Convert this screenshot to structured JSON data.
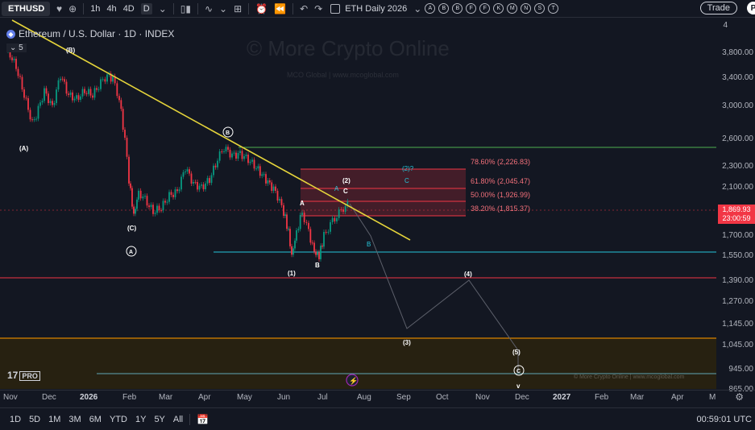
{
  "toolbar": {
    "symbol": "ETHUSD",
    "timeframes": [
      "1h",
      "4h",
      "4D",
      "D"
    ],
    "layout_name": "ETH Daily 2026",
    "drawing_tools": [
      "A",
      "B",
      "B",
      "F",
      "F",
      "K",
      "M",
      "N",
      "S",
      "T"
    ],
    "trade_label": "Trade",
    "profile_initial": "P"
  },
  "legend": {
    "title": "Ethereum / U.S. Dollar · 1D · INDEX",
    "indicators_count": "5"
  },
  "watermark": {
    "main": "© More Crypto Online",
    "sub": "MCO Global  |  www.mcoglobal.com",
    "bottom": "© More Crypto Online  |  www.mcoglobal.com"
  },
  "price_axis": {
    "labels": [
      "3,800.00",
      "3,400.00",
      "3,000.00",
      "2,600.00",
      "2,300.00",
      "2,100.00",
      "1,900.00",
      "1,700.00",
      "1,550.00",
      "1,390.00",
      "1,270.00",
      "1,145.00",
      "1,045.00",
      "945.00",
      "865.00"
    ],
    "top_value": "4",
    "current_price": "1,869.93",
    "countdown": "23:00:59"
  },
  "time_axis": {
    "labels": [
      "Nov",
      "Dec",
      "2026",
      "Feb",
      "Mar",
      "Apr",
      "May",
      "Jun",
      "Jul",
      "Aug",
      "Sep",
      "Oct",
      "Nov",
      "Dec",
      "2027",
      "Feb",
      "Mar",
      "Apr",
      "M"
    ]
  },
  "fib_levels": [
    {
      "label": "78.60% (2,226.83)"
    },
    {
      "label": "61.80% (2,045.47)"
    },
    {
      "label": "50.00% (1,926.99)"
    },
    {
      "label": "38.20% (1,815.37)"
    }
  ],
  "wave_labels": {
    "A_paren": "(A)",
    "B_paren": "(B)",
    "C_paren": "(C)",
    "A_circle": "A",
    "B_circle": "B",
    "C_circle": "C",
    "w1": "(1)",
    "w2": "(2)",
    "w2q": "(2)?",
    "w3": "(3)",
    "w4": "(4)",
    "w5": "(5)",
    "a": "A",
    "b": "B",
    "c": "C",
    "a_blue": "A",
    "b_blue": "B",
    "c_blue": "C",
    "v": "v"
  },
  "bottombar": {
    "ranges": [
      "1D",
      "5D",
      "1M",
      "3M",
      "6M",
      "YTD",
      "1Y",
      "5Y",
      "All"
    ],
    "clock": "00:59:01 UTC"
  },
  "brand": {
    "logo": "17",
    "badge": "PRO"
  },
  "colors": {
    "background": "#131722",
    "trendline": "#e5d43b",
    "fib_zone": "#f23645",
    "green_line": "#4caf50",
    "cyan_line": "#26c6da",
    "red_line": "#f23645",
    "orange_line": "#ff9800",
    "up_candle": "#089981",
    "down_candle": "#f23645"
  },
  "icons": [
    "heart-icon",
    "plus-icon",
    "chevron-down-icon",
    "candle-icon",
    "indicators-icon",
    "layout-icon",
    "alert-icon",
    "replay-icon",
    "undo-icon",
    "redo-icon",
    "calendar-icon",
    "gear-icon",
    "lightning-icon"
  ]
}
